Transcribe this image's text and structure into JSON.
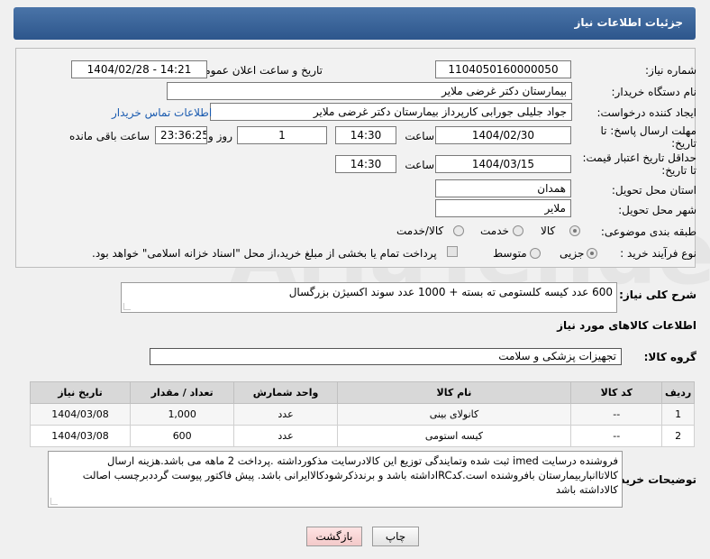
{
  "header": {
    "title": "جزئیات اطلاعات نیاز"
  },
  "form": {
    "need_number_label": "شماره نیاز:",
    "need_number": "1104050160000050",
    "announce_label": "تاریخ و ساعت اعلان عمومی:",
    "announce_value": "1404/02/28 - 14:21",
    "buyer_org_label": "نام دستگاه خریدار:",
    "buyer_org": "بیمارستان دکتر غرضی ملایر",
    "creator_label": "ایجاد کننده درخواست:",
    "creator": "جواد جلیلی جورابی کارپرداز بیمارستان دکتر غرضی ملایر",
    "contact_link": "اطلاعات تماس خریدار",
    "deadline_label_1": "مهلت ارسال پاسخ: تا",
    "deadline_label_2": "تاریخ:",
    "deadline_date": "1404/02/30",
    "time_label": "ساعت",
    "deadline_time": "14:30",
    "days_value": "1",
    "days_label": "روز و",
    "remaining_value": "23:36:25",
    "remaining_label": "ساعت باقی مانده",
    "validity_label_1": "حداقل تاریخ اعتبار قیمت:",
    "validity_label_2": "تا تاریخ:",
    "validity_date": "1404/03/15",
    "validity_time": "14:30",
    "province_label": "استان محل تحویل:",
    "province": "همدان",
    "city_label": "شهر محل تحویل:",
    "city": "ملایر",
    "category_label": "طبقه بندی موضوعی:",
    "category_options": [
      "کالا",
      "خدمت",
      "کالا/خدمت"
    ],
    "category_selected": "کالا",
    "process_label": "نوع فرآیند خرید :",
    "process_options": [
      "جزیی",
      "متوسط"
    ],
    "process_selected": "جزیی",
    "payment_note": "پرداخت تمام یا بخشی از مبلغ خرید،از محل \"اسناد خزانه اسلامی\" خواهد بود."
  },
  "description": {
    "label": "شرح کلی نیاز:",
    "text": "600 عدد کیسه کلستومی ته بسته  +  1000 عدد سوند اکسیژن بزرگسال"
  },
  "goods": {
    "section_title": "اطلاعات کالاهای مورد نیاز",
    "group_label": "گروه کالا:",
    "group_value": "تجهیزات پزشکی و سلامت",
    "columns": [
      "ردیف",
      "کد کالا",
      "نام کالا",
      "واحد شمارش",
      "تعداد / مقدار",
      "تاریخ نیاز"
    ],
    "rows": [
      {
        "row": "1",
        "code": "--",
        "name": "کانولای بینی",
        "unit": "عدد",
        "qty": "1,000",
        "date": "1404/03/08"
      },
      {
        "row": "2",
        "code": "--",
        "name": "کیسه استومی",
        "unit": "عدد",
        "qty": "600",
        "date": "1404/03/08"
      }
    ]
  },
  "buyer_notes": {
    "label": "توضیحات خریدار:",
    "text": "فروشنده درسایت imed ثبت شده وتمایندگی توزیع این کالادرسایت مذکورداشته .پرداخت 2 ماهه می باشد.هزینه ارسال کالاتاانباربیمارستان بافروشنده است.کدIRCداشته باشد و برندذکرشودکالاایرانی باشد. پیش فاکتور پیوست گرددبرچسب اصالت کالاداشته باشد"
  },
  "buttons": {
    "print": "چاپ",
    "back": "بازگشت"
  },
  "watermark": "AriaTender.net"
}
